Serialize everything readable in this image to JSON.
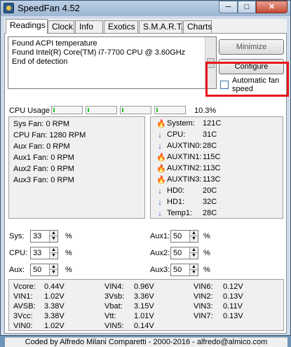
{
  "window": {
    "title": "SpeedFan 4.52",
    "min_glyph": "─",
    "max_glyph": "□",
    "close_glyph": "✕"
  },
  "tabs": [
    {
      "label": "Readings",
      "active": true
    },
    {
      "label": "Clock"
    },
    {
      "label": "Info"
    },
    {
      "label": "Exotics"
    },
    {
      "label": "S.M.A.R.T."
    },
    {
      "label": "Charts"
    }
  ],
  "log": {
    "lines": [
      "Found ACPI temperature",
      "Found Intel(R) Core(TM) i7-7700 CPU @ 3.60GHz",
      "End of detection"
    ]
  },
  "buttons": {
    "minimize": "Minimize",
    "configure": "Configure"
  },
  "automatic_fan_speed": {
    "label": "Automatic fan speed",
    "checked": false
  },
  "cpu_usage": {
    "label": "CPU Usage",
    "percent": "10.3%",
    "segments": 4
  },
  "fans": [
    {
      "label": "Sys Fan:",
      "value": "0 RPM"
    },
    {
      "label": "CPU Fan:",
      "value": "1280 RPM"
    },
    {
      "label": "Aux Fan:",
      "value": "0 RPM"
    },
    {
      "label": "Aux1 Fan:",
      "value": "0 RPM"
    },
    {
      "label": "Aux2 Fan:",
      "value": "0 RPM"
    },
    {
      "label": "Aux3 Fan:",
      "value": "0 RPM"
    }
  ],
  "temps": [
    {
      "icon": "fire",
      "label": "System:",
      "value": "121C"
    },
    {
      "icon": "down",
      "label": "CPU:",
      "value": "31C"
    },
    {
      "icon": "down",
      "label": "AUXTIN0:",
      "value": "28C"
    },
    {
      "icon": "fire",
      "label": "AUXTIN1:",
      "value": "115C"
    },
    {
      "icon": "fire",
      "label": "AUXTIN2:",
      "value": "113C"
    },
    {
      "icon": "fire",
      "label": "AUXTIN3:",
      "value": "113C"
    },
    {
      "icon": "down",
      "label": "HD0:",
      "value": "20C"
    },
    {
      "icon": "down",
      "label": "HD1:",
      "value": "32C"
    },
    {
      "icon": "down",
      "label": "Temp1:",
      "value": "28C"
    }
  ],
  "icons": {
    "fire": "🔥",
    "down": "↓"
  },
  "speeds": {
    "left": [
      {
        "label": "Sys:",
        "value": "33",
        "unit": "%"
      },
      {
        "label": "CPU:",
        "value": "33",
        "unit": "%"
      },
      {
        "label": "Aux:",
        "value": "50",
        "unit": "%"
      }
    ],
    "right": [
      {
        "label": "Aux1:",
        "value": "50",
        "unit": "%"
      },
      {
        "label": "Aux2:",
        "value": "50",
        "unit": "%"
      },
      {
        "label": "Aux3:",
        "value": "50",
        "unit": "%"
      }
    ]
  },
  "voltages": {
    "col1": [
      {
        "label": "Vcore:",
        "value": "0.44V"
      },
      {
        "label": "VIN1:",
        "value": "1.02V"
      },
      {
        "label": "AVSB:",
        "value": "3.38V"
      },
      {
        "label": "3Vcc:",
        "value": "3.38V"
      },
      {
        "label": "VIN0:",
        "value": "1.02V"
      }
    ],
    "col2": [
      {
        "label": "VIN4:",
        "value": "0.96V"
      },
      {
        "label": "3Vsb:",
        "value": "3.36V"
      },
      {
        "label": "Vbat:",
        "value": "3.15V"
      },
      {
        "label": "Vtt:",
        "value": "1.01V"
      },
      {
        "label": "VIN5:",
        "value": "0.14V"
      }
    ],
    "col3": [
      {
        "label": "VIN6:",
        "value": "0.12V"
      },
      {
        "label": "VIN2:",
        "value": "0.13V"
      },
      {
        "label": "VIN3:",
        "value": "0.11V"
      },
      {
        "label": "VIN7:",
        "value": "0.13V"
      }
    ]
  },
  "footer": "Coded by Alfredo Milani Comparetti - 2000-2016 - alfredo@almico.com",
  "colors": {
    "highlight_box": "#e8141b",
    "usage_fill": "#28c428"
  }
}
